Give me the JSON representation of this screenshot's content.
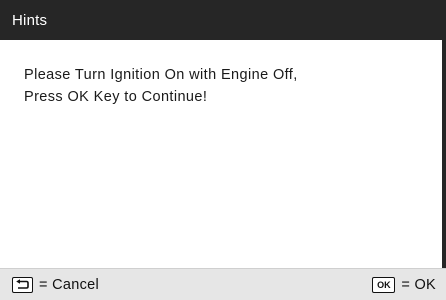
{
  "dialog": {
    "title": "Hints",
    "message_lines": [
      "Please Turn Ignition On with Engine Off,",
      "Press OK Key to Continue!"
    ]
  },
  "footer": {
    "cancel": {
      "icon": "back-key-icon",
      "label": "= Cancel"
    },
    "ok": {
      "icon": "ok-key-icon",
      "key_text": "OK",
      "label": "= OK"
    }
  },
  "colors": {
    "titlebar_bg": "#262626",
    "titlebar_text": "#ffffff",
    "content_bg": "#ffffff",
    "footer_bg": "#e6e6e6"
  }
}
